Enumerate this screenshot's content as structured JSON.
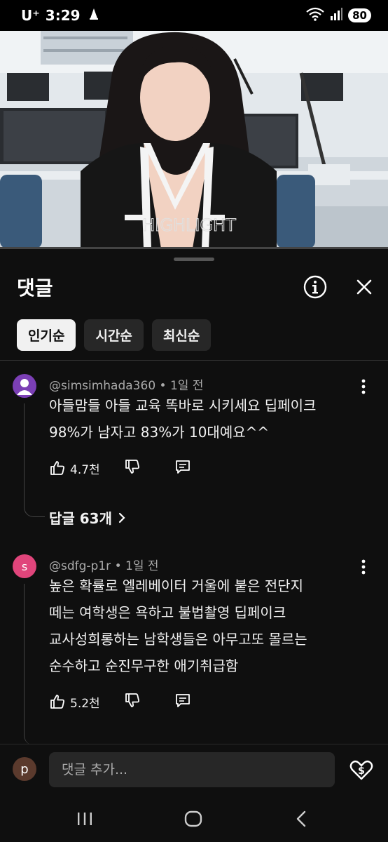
{
  "status_bar": {
    "carrier": "U⁺",
    "time": "3:29",
    "battery": "80"
  },
  "video": {
    "caption": "HIGHLIGHT",
    "progress_percent": 0
  },
  "panel": {
    "title": "댓글",
    "chips": [
      {
        "label": "인기순",
        "active": true
      },
      {
        "label": "시간순",
        "active": false
      },
      {
        "label": "최신순",
        "active": false
      }
    ]
  },
  "comments": [
    {
      "author": "@simsimhada360",
      "time": "1일 전",
      "text_lines": [
        "아들맘들 아들 교육 똑바로 시키세요 딥페이크",
        "98%가 남자고 83%가 10대예요^^"
      ],
      "likes": "4.7천",
      "replies": "답글 63개",
      "avatar_color": "#7b3fb5"
    },
    {
      "author": "@sdfg-p1r",
      "time": "1일 전",
      "avatar_letter": "s",
      "text_lines": [
        "높은 확률로 엘레베이터 거울에 붙은 전단지",
        "떼는 여학생은 욕하고 불법촬영 딥페이크",
        "교사성희롱하는 남학생들은 아무고또 몰르는",
        "순수하고 순진무구한 애기취급함"
      ],
      "likes": "5.2천",
      "avatar_color": "#e0457b"
    }
  ],
  "add_comment": {
    "avatar_letter": "p",
    "placeholder": "댓글 추가..."
  },
  "colors": {
    "background": "#0f0f0f",
    "chip_bg": "#272727",
    "chip_active_bg": "#f1f1f1"
  }
}
